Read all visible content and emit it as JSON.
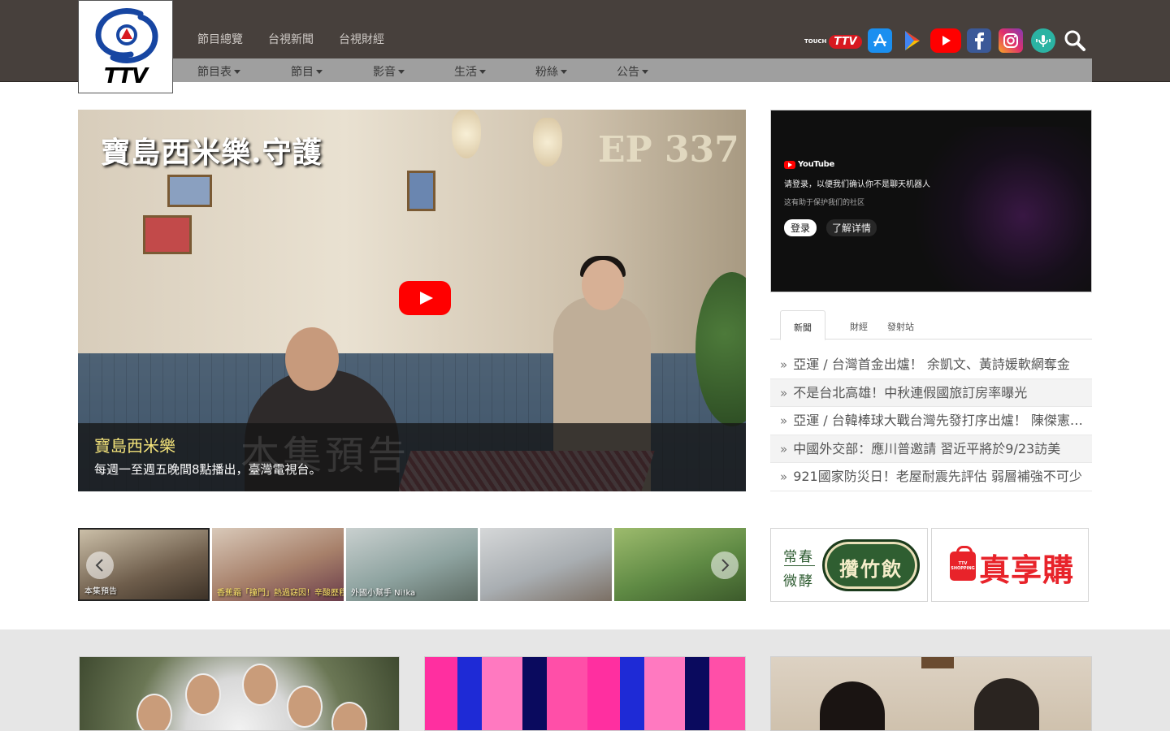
{
  "brand": {
    "logo_text": "TTV"
  },
  "top_nav": [
    "節目總覽",
    "台視新聞",
    "台視財經"
  ],
  "sub_nav": [
    "節目表",
    "節目",
    "影音",
    "生活",
    "粉絲",
    "公告"
  ],
  "social_icons": {
    "touch_ttv": {
      "small": "TOUCH",
      "big": "TTV"
    },
    "items": [
      "app-store-icon",
      "google-play-icon",
      "youtube-icon",
      "facebook-icon",
      "instagram-icon",
      "podcast-icon",
      "search-icon"
    ]
  },
  "hero": {
    "overlay_title": "寶島西米樂.守護",
    "overlay_episode": "EP 337",
    "watermark": "本集預告",
    "title": "寶島西米樂",
    "description": "每週一至週五晚間8點播出，臺灣電視台。"
  },
  "youtube_embed": {
    "brand": "YouTube",
    "message": "请登录，以便我们确认你不是聊天机器人",
    "sub_message": "这有助于保护我们的社区",
    "login_label": "登录",
    "learn_more_label": "了解详情"
  },
  "news_tabs": [
    "新聞",
    "財經",
    "發射站"
  ],
  "news_items": [
    "亞運 / 台灣首金出爐！ 余凱文、黃詩媛軟網奪金",
    "不是台北高雄！中秋連假國旅訂房率曝光",
    "亞運 / 台韓棒球大戰台灣先發打序出爐！ 陳傑憲領軍",
    "中國外交部：應川普邀請 習近平將於9/23訪美",
    "921國家防災日！老屋耐震先評估 弱層補強不可少"
  ],
  "thumbnails": [
    {
      "label": "本集預告"
    },
    {
      "label": "香蕉霜「撞門」熱過窈因！辛酸歷程惹哭家人"
    },
    {
      "label": "外國小幫手 Ni!ka"
    },
    {
      "label": ""
    },
    {
      "label": ""
    }
  ],
  "ads": {
    "ad1": {
      "left_top": "常春",
      "left_bottom": "微酵",
      "badge": "攢竹飲"
    },
    "ad2": {
      "bag_text": "TTV SHOPPING",
      "brand": "真享購"
    }
  },
  "colors": {
    "header_bg": "#47403c",
    "subnav_bg": "#9f9f9f",
    "hero_title": "#f3e37a",
    "youtube_red": "#ff0000",
    "brand_red": "#e8232a"
  }
}
